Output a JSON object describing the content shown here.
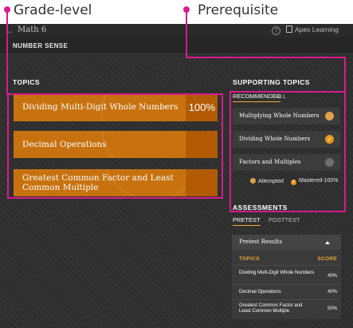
{
  "annotations": {
    "left": "Grade-level",
    "right": "Prerequisite"
  },
  "topbar": {
    "back_icon": "arrow-left-icon",
    "course_title": "Math 6",
    "help_icon": "?",
    "brand": "Apex Learning"
  },
  "unit_title": "NUMBER SENSE",
  "topics": {
    "heading": "TOPICS",
    "items": [
      {
        "label": "Dividing Multi-Digit Whole Numbers",
        "score": "100%"
      },
      {
        "label": "Decimal Operations",
        "score": ""
      },
      {
        "label": "Greatest Common Factor and Least Common Multiple",
        "score": ""
      }
    ]
  },
  "supporting": {
    "heading": "SUPPORTING TOPICS",
    "tabs": [
      "RECOMMENDED",
      "ALL"
    ],
    "active_tab": "RECOMMENDED",
    "items": [
      {
        "label": "Multiplying Whole Numbers",
        "status": "attempted"
      },
      {
        "label": "Dividing Whole Numbers",
        "status": "mastered"
      },
      {
        "label": "Factors and Multiples",
        "status": "none"
      }
    ],
    "legend": {
      "attempted": "Attempted",
      "mastered": "Mastered-100%"
    }
  },
  "assessments": {
    "heading": "ASSESSMENTS",
    "tabs": [
      "PRETEST",
      "POSTTEST"
    ],
    "active_tab": "PRETEST",
    "panel_title": "Pretest Results",
    "col_topics": "TOPICS",
    "col_score": "SCORE",
    "rows": [
      {
        "topic": "Dividing Multi-Digit Whole Numbers",
        "score": "40%"
      },
      {
        "topic": "Decimal Operations",
        "score": "40%"
      },
      {
        "topic": "Greatest Common Factor and Least Common Multiple",
        "score": "50%"
      }
    ]
  },
  "colors": {
    "accent_magenta": "#d81b8c",
    "topic_orange": "#c8720f",
    "attempted": "#e0a04a",
    "mastered": "#e49a1e",
    "not_started": "#6e6e6e"
  }
}
